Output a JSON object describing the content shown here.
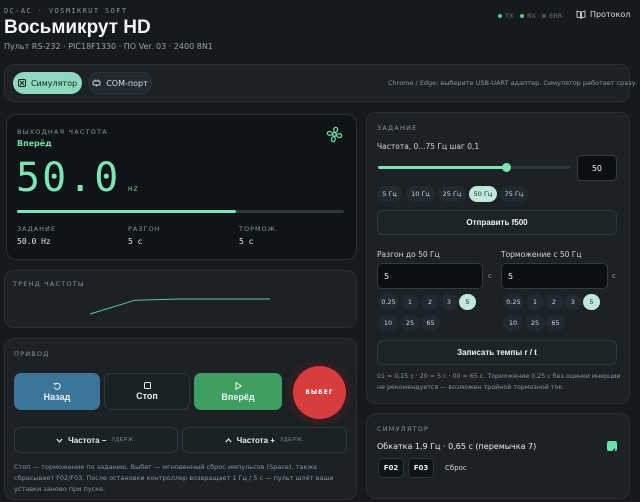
{
  "header": {
    "brand": "DC-AC · VOSMIKRUT SOFT",
    "title": "Восьмикрут HD",
    "subtitle": "Пульт RS-232 · PIC18F1330 · ПО Ver. 03 · 2400 8N1",
    "status": [
      {
        "label": "TX",
        "color": "#3fcf8e"
      },
      {
        "label": "RX",
        "color": "#3fcf8e"
      },
      {
        "label": "ERR",
        "color": "#4a545a"
      }
    ],
    "protocol_label": "Протокол"
  },
  "toolbar": {
    "simulator_label": "Симулятор",
    "com_label": "COM-порт",
    "hint": "Chrome / Edge: выберите USB-UART адаптер. Симулятор работает сразу."
  },
  "output": {
    "caption": "ВЫХОДНАЯ ЧАСТОТА",
    "direction": "Вперёд",
    "frequency": "50.0",
    "unit": "HZ",
    "progress_fraction": 0.67,
    "stats": [
      {
        "key": "ЗАДАНИЕ",
        "value": "50.0 Hz"
      },
      {
        "key": "РАЗГОН",
        "value": "5 с"
      },
      {
        "key": "ТОРМОЖ.",
        "value": "5 с"
      }
    ]
  },
  "trend": {
    "caption": "ТРЕНД ЧАСТОТЫ",
    "points": [
      0,
      46,
      50,
      50,
      50
    ]
  },
  "drive": {
    "caption": "ПРИВОД",
    "back_label": "Назад",
    "stop_label": "Стоп",
    "forward_label": "Вперёд",
    "estop_label": "ВЫБЕГ",
    "jog_down_label": "Частота −",
    "jog_up_label": "Частота +",
    "hold_label": "УДЕРЖ.",
    "note": "Стоп — торможение по заданию. Выбег — мгновенный сброс импульсов (Space), также сбрасывает F02/F03. После остановки контроллер возвращает 1 Гц / 5 с — пульт шлёт ваши уставки заново при пуске."
  },
  "setpoint": {
    "caption": "ЗАДАНИЕ",
    "range_label": "Частота, 0...75 Гц шаг 0,1",
    "slider_fraction": 0.667,
    "value": "50",
    "presets": [
      {
        "label": "5 Гц",
        "active": false
      },
      {
        "label": "10 Гц",
        "active": false
      },
      {
        "label": "25 Гц",
        "active": false
      },
      {
        "label": "50 Гц",
        "active": true
      },
      {
        "label": "75 Гц",
        "active": false
      }
    ],
    "send_label": "Отправить f500",
    "accel_label": "Разгон до 50 Гц",
    "accel_value": "5",
    "decel_label": "Торможение с 50 Гц",
    "decel_value": "5",
    "unit": "с",
    "time_chips": [
      "0.25",
      "1",
      "2",
      "3",
      "5",
      "10",
      "25",
      "65"
    ],
    "active_chip": "5",
    "write_label": "Записать темпы r / t",
    "note": "01 = 0,25 с · 20 = 5 с · 00 = 65 с. Торможение 0,25 с без оценки инерции не рекомендуется — возможен тройной тормозной ток."
  },
  "simulator": {
    "caption": "СИМУЛЯТОР",
    "winding_label": "Обкатка 1,9 Гц · 0,65 с (перемычка 7)",
    "winding_checked": true,
    "f02_label": "F02",
    "f03_label": "F03",
    "reset_label": "Сброс"
  }
}
